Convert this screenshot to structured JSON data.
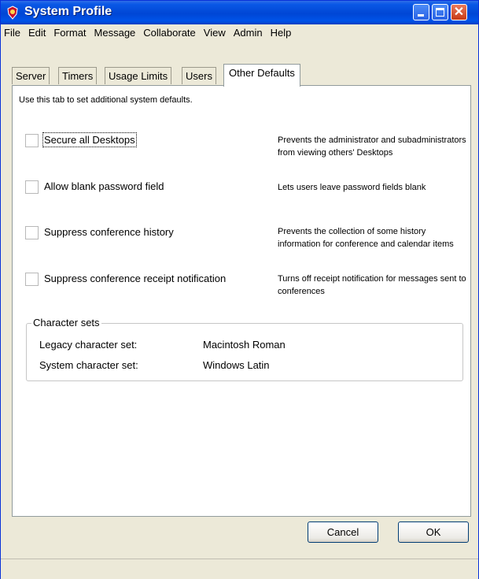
{
  "window": {
    "title": "System Profile"
  },
  "menu": [
    "File",
    "Edit",
    "Format",
    "Message",
    "Collaborate",
    "View",
    "Admin",
    "Help"
  ],
  "tabs": [
    {
      "label": "Server"
    },
    {
      "label": "Timers"
    },
    {
      "label": "Usage Limits"
    },
    {
      "label": "Users"
    },
    {
      "label": "Other Defaults",
      "active": true
    }
  ],
  "panel": {
    "intro": "Use this tab to set additional system defaults.",
    "options": [
      {
        "label": "Secure all Desktops",
        "checked": false,
        "description": "Prevents the administrator and subadministrators from viewing others' Desktops"
      },
      {
        "label": "Allow blank password field",
        "checked": false,
        "description": "Lets users leave password fields blank"
      },
      {
        "label": "Suppress conference history",
        "checked": false,
        "description": "Prevents the collection of some history information for conference and calendar items"
      },
      {
        "label": "Suppress conference receipt notification",
        "checked": false,
        "description": "Turns off receipt notification for messages sent to conferences"
      }
    ],
    "charsets": {
      "legend": "Character sets",
      "legacy_label": "Legacy character set:",
      "legacy_value": "Macintosh Roman",
      "system_label": "System character set:",
      "system_value": "Windows Latin"
    }
  },
  "buttons": {
    "cancel": "Cancel",
    "ok": "OK"
  },
  "colors": {
    "titlebar": "#0054e3",
    "accent_close": "#c83a15"
  }
}
